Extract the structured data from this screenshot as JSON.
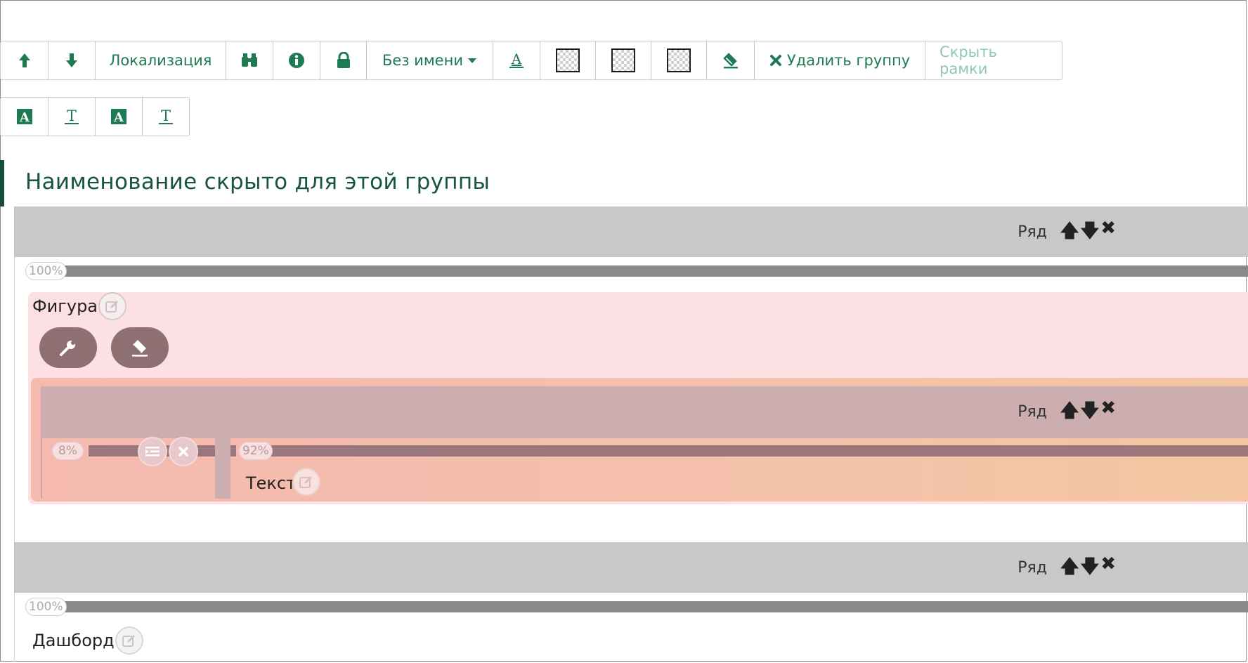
{
  "toolbar": {
    "localization_label": "Локализация",
    "name_dropdown_label": "Без имени",
    "delete_group_label": "Удалить группу",
    "hide_frames_label": "Скрыть рамки"
  },
  "group": {
    "title": "Наименование скрыто для этой группы"
  },
  "rows": [
    {
      "label": "Ряд",
      "width_label": "100%"
    },
    {
      "label": "Ряд"
    },
    {
      "label": "Ряд",
      "width_label": "100%"
    }
  ],
  "figure": {
    "label": "Фигура",
    "nested_row_label": "Ряд",
    "col1_width": "8%",
    "col2_width": "92%",
    "text_label": "Текст"
  },
  "dashboard": {
    "label": "Дашборд"
  },
  "colors": {
    "accent": "#1e7a52",
    "title": "#17553f",
    "figure_bg": "#fde0e3",
    "row_header": "#c8c8c8"
  }
}
